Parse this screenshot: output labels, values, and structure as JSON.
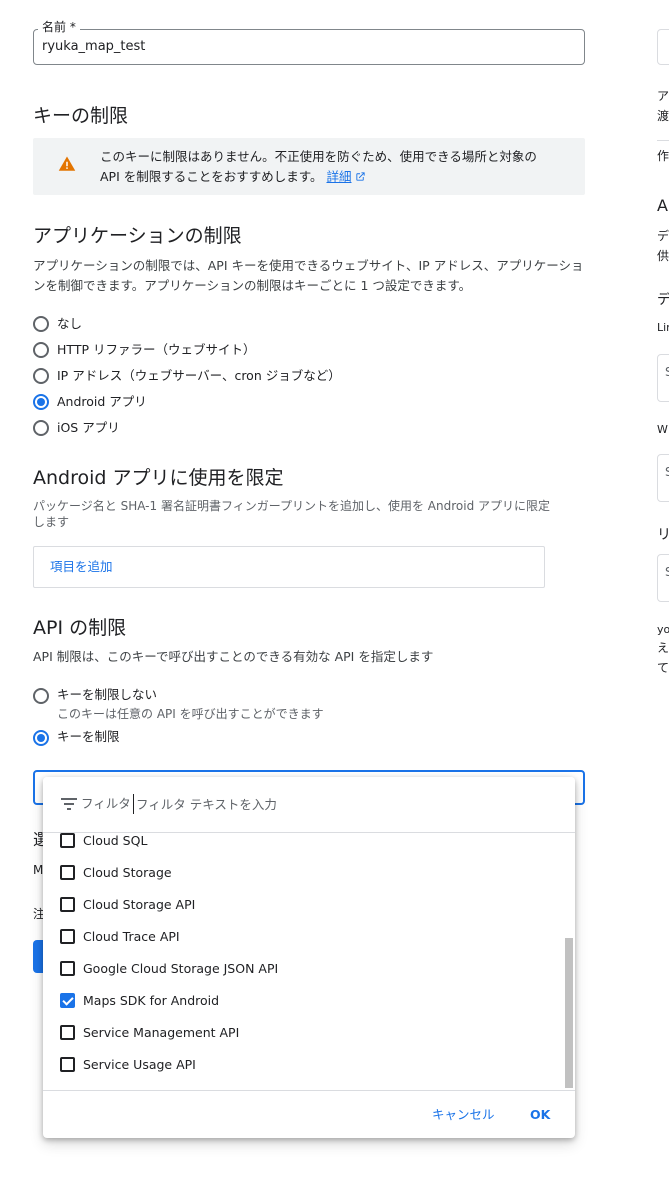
{
  "name_field": {
    "label": "名前 *",
    "value": "ryuka_map_test"
  },
  "key_restrictions": {
    "title": "キーの制限",
    "warning_text": "このキーに制限はありません。不正使用を防ぐため、使用できる場所と対象の API を制限することをおすすめします。",
    "warning_link": "詳細"
  },
  "app_restrictions": {
    "title": "アプリケーションの制限",
    "description": "アプリケーションの制限では、API キーを使用できるウェブサイト、IP アドレス、アプリケーションを制御できます。アプリケーションの制限はキーごとに 1 つ設定できます。",
    "options": [
      {
        "label": "なし",
        "selected": false
      },
      {
        "label": "HTTP リファラー（ウェブサイト）",
        "selected": false
      },
      {
        "label": "IP アドレス（ウェブサーバー、cron ジョブなど）",
        "selected": false
      },
      {
        "label": "Android アプリ",
        "selected": true
      },
      {
        "label": "iOS アプリ",
        "selected": false
      }
    ]
  },
  "android_section": {
    "title": "Android アプリに使用を限定",
    "description": "パッケージ名と SHA-1 署名証明書フィンガープリントを追加し、使用を Android アプリに限定します",
    "add_item": "項目を追加"
  },
  "api_restrictions": {
    "title": "API の制限",
    "description": "API 制限は、このキーで呼び出すことのできる有効な API を指定します",
    "options": [
      {
        "label": "キーを制限しない",
        "sub": "このキーは任意の API を呼び出すことができます",
        "selected": false
      },
      {
        "label": "キーを制限",
        "selected": true
      }
    ]
  },
  "hidden_fragments": {
    "label1": "選",
    "label2": "M",
    "label3": "注"
  },
  "dropdown": {
    "filter_label": "フィルタ",
    "filter_placeholder": "フィルタ テキストを入力",
    "items": [
      {
        "label": "Cloud SQL",
        "checked": false
      },
      {
        "label": "Cloud Storage",
        "checked": false
      },
      {
        "label": "Cloud Storage API",
        "checked": false
      },
      {
        "label": "Cloud Trace API",
        "checked": false
      },
      {
        "label": "Google Cloud Storage JSON API",
        "checked": false
      },
      {
        "label": "Maps SDK for Android",
        "checked": true
      },
      {
        "label": "Service Management API",
        "checked": false
      },
      {
        "label": "Service Usage API",
        "checked": false
      }
    ],
    "cancel_label": "キャンセル",
    "ok_label": "OK"
  },
  "right_column": {
    "f1": "ア",
    "f2": "渡",
    "f3": "作",
    "f4": "A",
    "f5": "デ",
    "f6": "供",
    "f7": "デ",
    "f8": "Lin",
    "f9": "S",
    "f10": "W",
    "f11": "S",
    "f12": "リ",
    "f13": "S",
    "f14": "yo",
    "f15": "え",
    "f16": "て"
  },
  "colors": {
    "accent": "#1a73e8",
    "warning": "#e37400",
    "panel_bg": "#f1f3f4"
  },
  "icons": {
    "warning": "warning-icon",
    "external": "external-link-icon",
    "filter": "filter-icon"
  }
}
